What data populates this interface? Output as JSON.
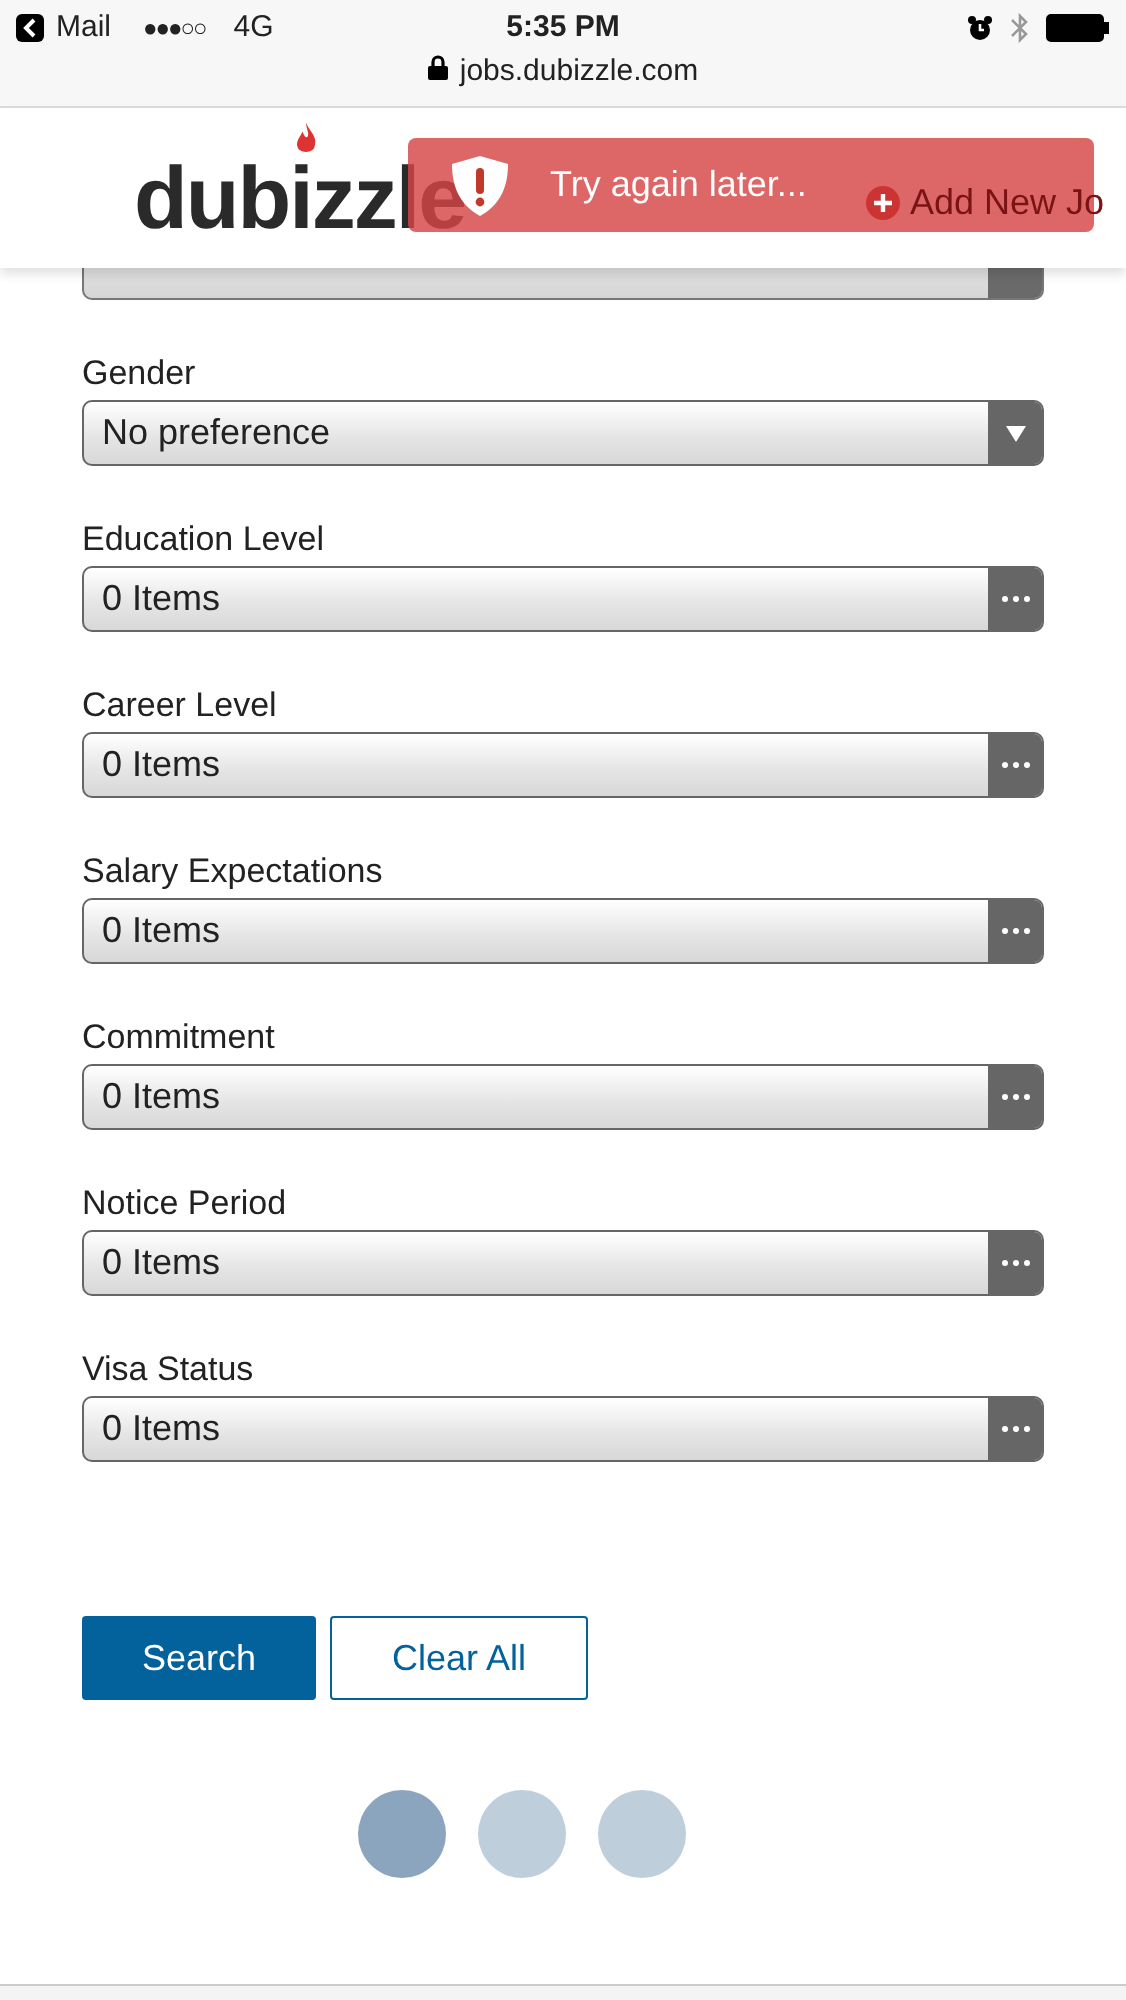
{
  "status_bar": {
    "back_app": "Mail",
    "carrier": "●●●○○",
    "network": "4G",
    "time": "5:35 PM"
  },
  "address_bar": {
    "url": "jobs.dubizzle.com"
  },
  "header": {
    "logo": "dubizzle",
    "nav": [
      {
        "label": "Add New Jo",
        "kind": "add"
      }
    ]
  },
  "toast": {
    "message": "Try again later..."
  },
  "fields": [
    {
      "kind": "select",
      "value": "No preference",
      "label": "Gender"
    },
    {
      "kind": "multi",
      "label": "Education Level",
      "value": "0 Items"
    },
    {
      "kind": "multi",
      "label": "Career Level",
      "value": "0 Items"
    },
    {
      "kind": "multi",
      "label": "Salary Expectations",
      "value": "0 Items"
    },
    {
      "kind": "multi",
      "label": "Commitment",
      "value": "0 Items"
    },
    {
      "kind": "multi",
      "label": "Notice Period",
      "value": "0 Items"
    },
    {
      "kind": "multi",
      "label": "Visa Status",
      "value": "0 Items"
    }
  ],
  "buttons": [
    {
      "label": "Search",
      "kind": "primary"
    },
    {
      "label": "Clear All",
      "kind": "secondary"
    }
  ],
  "loader": [
    {
      "active": true
    },
    {
      "active": false
    },
    {
      "active": false
    }
  ]
}
